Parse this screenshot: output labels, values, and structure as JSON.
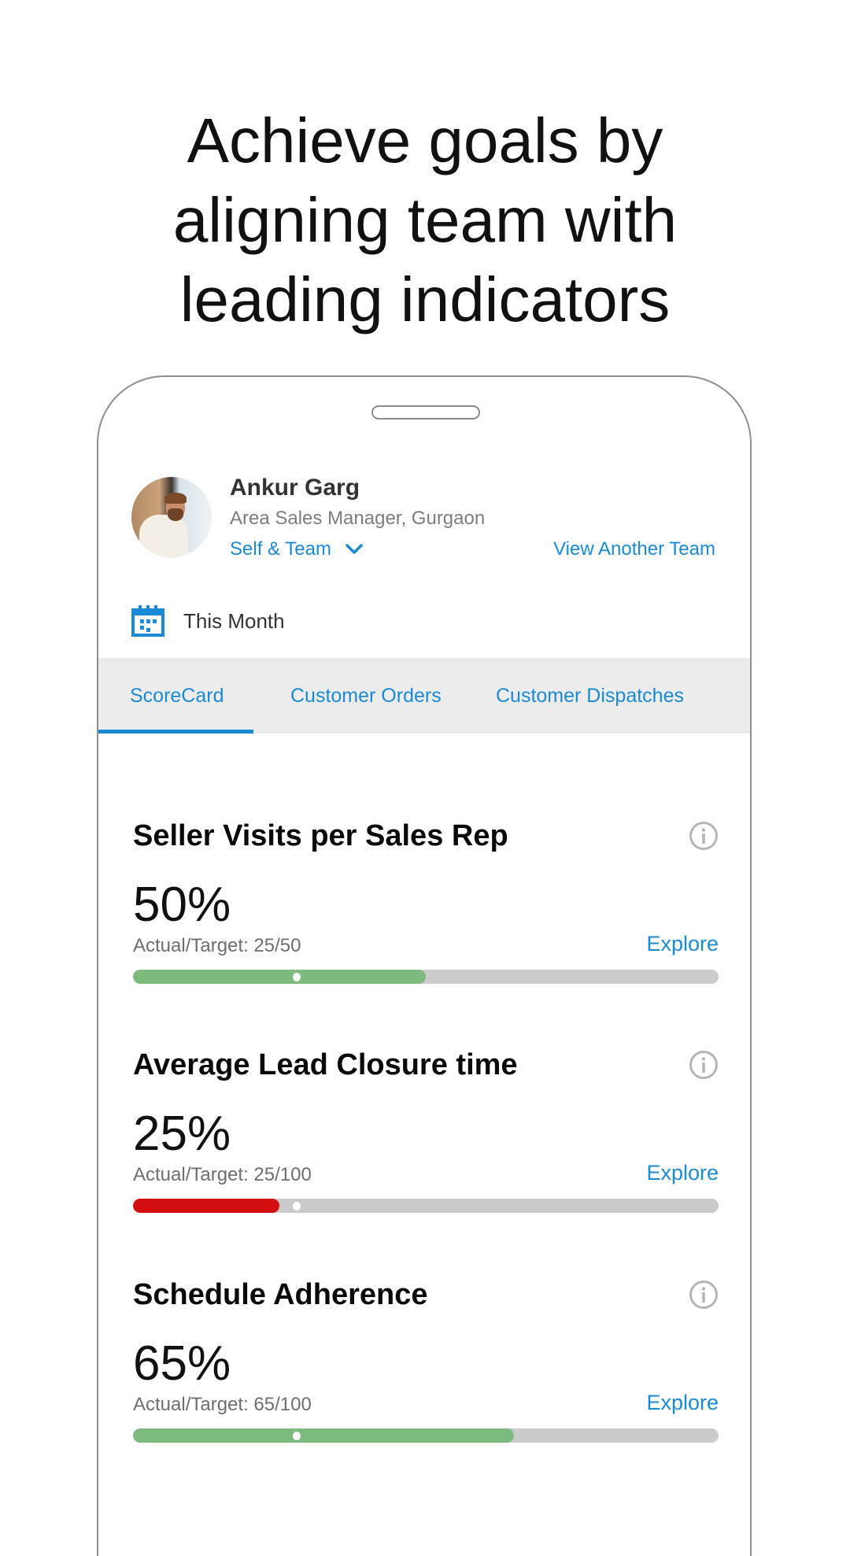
{
  "headline": {
    "lines": [
      "Achieve goals by",
      "aligning team with",
      "leading indicators"
    ]
  },
  "profile": {
    "name": "Ankur Garg",
    "role": "Area Sales Manager, Gurgaon",
    "scope_selected": "Self & Team",
    "view_another_team_label": "View Another Team",
    "avatar_icon": "user-photo"
  },
  "period": {
    "icon": "calendar-icon",
    "label": "This Month"
  },
  "tabs": [
    {
      "label": "ScoreCard",
      "active": true
    },
    {
      "label": "Customer Orders",
      "active": false
    },
    {
      "label": "Customer Dispatches",
      "active": false
    }
  ],
  "colors": {
    "accent": "#1a8ad4",
    "on_track": "#7dba7d",
    "off_track": "#d10f0f",
    "track": "#cbcbcb"
  },
  "metrics": [
    {
      "title": "Seller Visits per Sales Rep",
      "percent_label": "50%",
      "ratio_label": "Actual/Target: 25/50",
      "explore_label": "Explore",
      "progress": 0.5,
      "expected_marker": 0.28,
      "status": "on_track"
    },
    {
      "title": "Average Lead Closure time",
      "percent_label": "25%",
      "ratio_label": "Actual/Target: 25/100",
      "explore_label": "Explore",
      "progress": 0.25,
      "expected_marker": 0.28,
      "status": "off_track"
    },
    {
      "title": "Schedule Adherence",
      "percent_label": "65%",
      "ratio_label": "Actual/Target: 65/100",
      "explore_label": "Explore",
      "progress": 0.65,
      "expected_marker": 0.28,
      "status": "on_track"
    }
  ]
}
